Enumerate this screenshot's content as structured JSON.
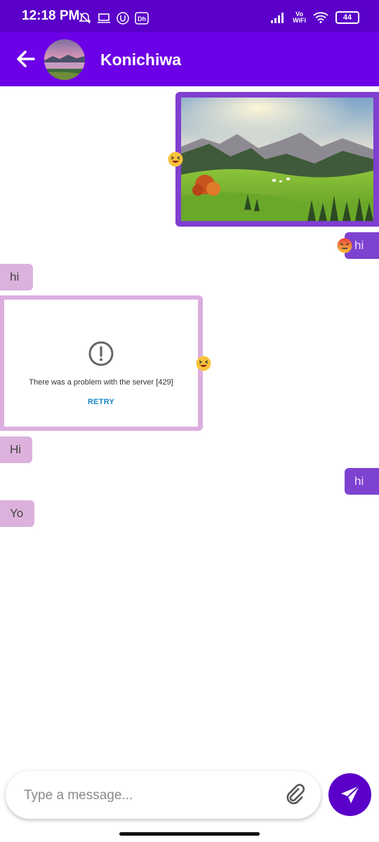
{
  "status_bar": {
    "time": "12:18 PM",
    "vowifi_top": "Vo",
    "vowifi_bottom": "WiFi",
    "battery": "44"
  },
  "header": {
    "title": "Konichiwa"
  },
  "messages": {
    "m2": {
      "text": "hi"
    },
    "m3": {
      "text": "hi"
    },
    "m5": {
      "text": "Hi"
    },
    "m6": {
      "text": "hi"
    },
    "m7": {
      "text": "Yo"
    }
  },
  "error_card": {
    "message": "There was a problem with the server [429]",
    "retry_label": "RETRY"
  },
  "composer": {
    "placeholder": "Type a message..."
  },
  "colors": {
    "status_bar": "#5a00c8",
    "app_bar": "#6c00e6",
    "outgoing_bubble": "#7e42d0",
    "incoming_bubble": "#dcb2dd",
    "send_button": "#5a00c8"
  }
}
